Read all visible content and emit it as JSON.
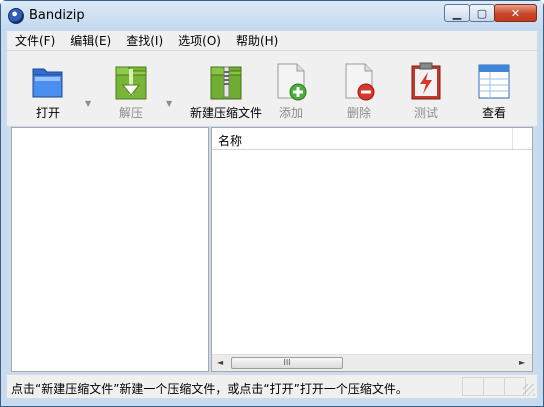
{
  "window": {
    "title": "Bandizip",
    "icon": "bandizip-app-icon"
  },
  "menubar": [
    {
      "label": "文件(F)"
    },
    {
      "label": "编辑(E)"
    },
    {
      "label": "查找(I)"
    },
    {
      "label": "选项(O)"
    },
    {
      "label": "帮助(H)"
    }
  ],
  "toolbar": {
    "open": {
      "label": "打开",
      "icon": "folder-open-icon",
      "enabled": true
    },
    "extract": {
      "label": "解压",
      "icon": "extract-icon",
      "enabled": false
    },
    "new_archive": {
      "label": "新建压缩文件",
      "icon": "new-archive-icon",
      "enabled": true
    },
    "add": {
      "label": "添加",
      "icon": "add-file-icon",
      "enabled": false
    },
    "delete": {
      "label": "删除",
      "icon": "delete-file-icon",
      "enabled": false
    },
    "test": {
      "label": "测试",
      "icon": "test-icon",
      "enabled": false
    },
    "view": {
      "label": "查看",
      "icon": "view-icon",
      "enabled": true
    }
  },
  "file_list": {
    "column_name": "名称",
    "scrollbar_thumb": "III"
  },
  "statusbar": {
    "text": "点击“新建压缩文件”新建一个压缩文件，或点击“打开”打开一个压缩文件。"
  },
  "colors": {
    "titlebar": "#c9dcef",
    "close_button": "#c7452b",
    "window_border": "#3c5f86"
  }
}
